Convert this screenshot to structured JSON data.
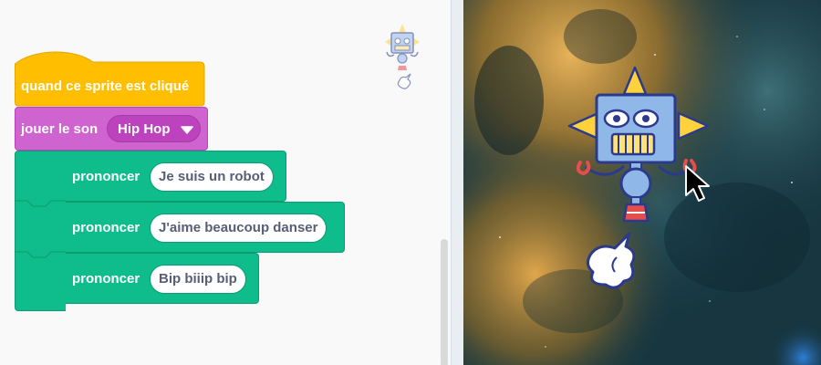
{
  "code_area": {
    "hat_block": {
      "label": "quand ce sprite est cliqué"
    },
    "sound_block": {
      "label": "jouer le son",
      "sound": "Hip Hop",
      "menu_icon": "triangle-down-icon"
    },
    "say_blocks": [
      {
        "label": "prononcer",
        "text": "Je suis un robot"
      },
      {
        "label": "prononcer",
        "text": "J'aime beaucoup danser"
      },
      {
        "label": "prononcer",
        "text": "Bip biiip bip"
      }
    ],
    "colors": {
      "events": "#ffbf00",
      "sound": "#cf63cf",
      "extension": "#0fbd8c"
    }
  },
  "stage": {
    "backdrop": "nebula-space",
    "sprite": "robot-sprite",
    "cursor": "mouse-cursor-icon"
  }
}
